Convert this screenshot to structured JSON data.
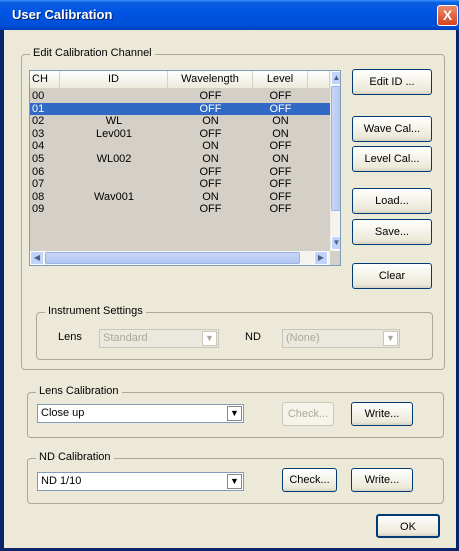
{
  "window": {
    "title": "User Calibration",
    "close_glyph": "X"
  },
  "edit_group": {
    "title": "Edit Calibration Channel",
    "columns": [
      "CH",
      "ID",
      "Wavelength",
      "Level"
    ],
    "rows": [
      {
        "ch": "00",
        "id": "",
        "wavelength": "OFF",
        "level": "OFF"
      },
      {
        "ch": "01",
        "id": "",
        "wavelength": "OFF",
        "level": "OFF"
      },
      {
        "ch": "02",
        "id": "WL",
        "wavelength": "ON",
        "level": "ON"
      },
      {
        "ch": "03",
        "id": "Lev001",
        "wavelength": "OFF",
        "level": "ON"
      },
      {
        "ch": "04",
        "id": "",
        "wavelength": "ON",
        "level": "OFF"
      },
      {
        "ch": "05",
        "id": "WL002",
        "wavelength": "ON",
        "level": "ON"
      },
      {
        "ch": "06",
        "id": "",
        "wavelength": "OFF",
        "level": "OFF"
      },
      {
        "ch": "07",
        "id": "",
        "wavelength": "OFF",
        "level": "OFF"
      },
      {
        "ch": "08",
        "id": "Wav001",
        "wavelength": "ON",
        "level": "OFF"
      },
      {
        "ch": "09",
        "id": "",
        "wavelength": "OFF",
        "level": "OFF"
      }
    ],
    "selected_row": "01",
    "buttons": {
      "edit_id": "Edit ID ...",
      "wave_cal": "Wave Cal...",
      "level_cal": "Level Cal...",
      "load": "Load...",
      "save": "Save...",
      "clear": "Clear"
    },
    "instrument": {
      "title": "Instrument Settings",
      "lens_label": "Lens",
      "lens_value": "Standard",
      "nd_label": "ND",
      "nd_value": "(None)"
    }
  },
  "lens_group": {
    "title": "Lens Calibration",
    "selected": "Close up",
    "check_label": "Check...",
    "write_label": "Write..."
  },
  "nd_group": {
    "title": "ND Calibration",
    "selected": "ND 1/10",
    "check_label": "Check...",
    "write_label": "Write..."
  },
  "ok_label": "OK",
  "colors": {
    "title_bar": "#0054e3",
    "selection": "#316ac5",
    "dialog_bg": "#ece9d8"
  }
}
